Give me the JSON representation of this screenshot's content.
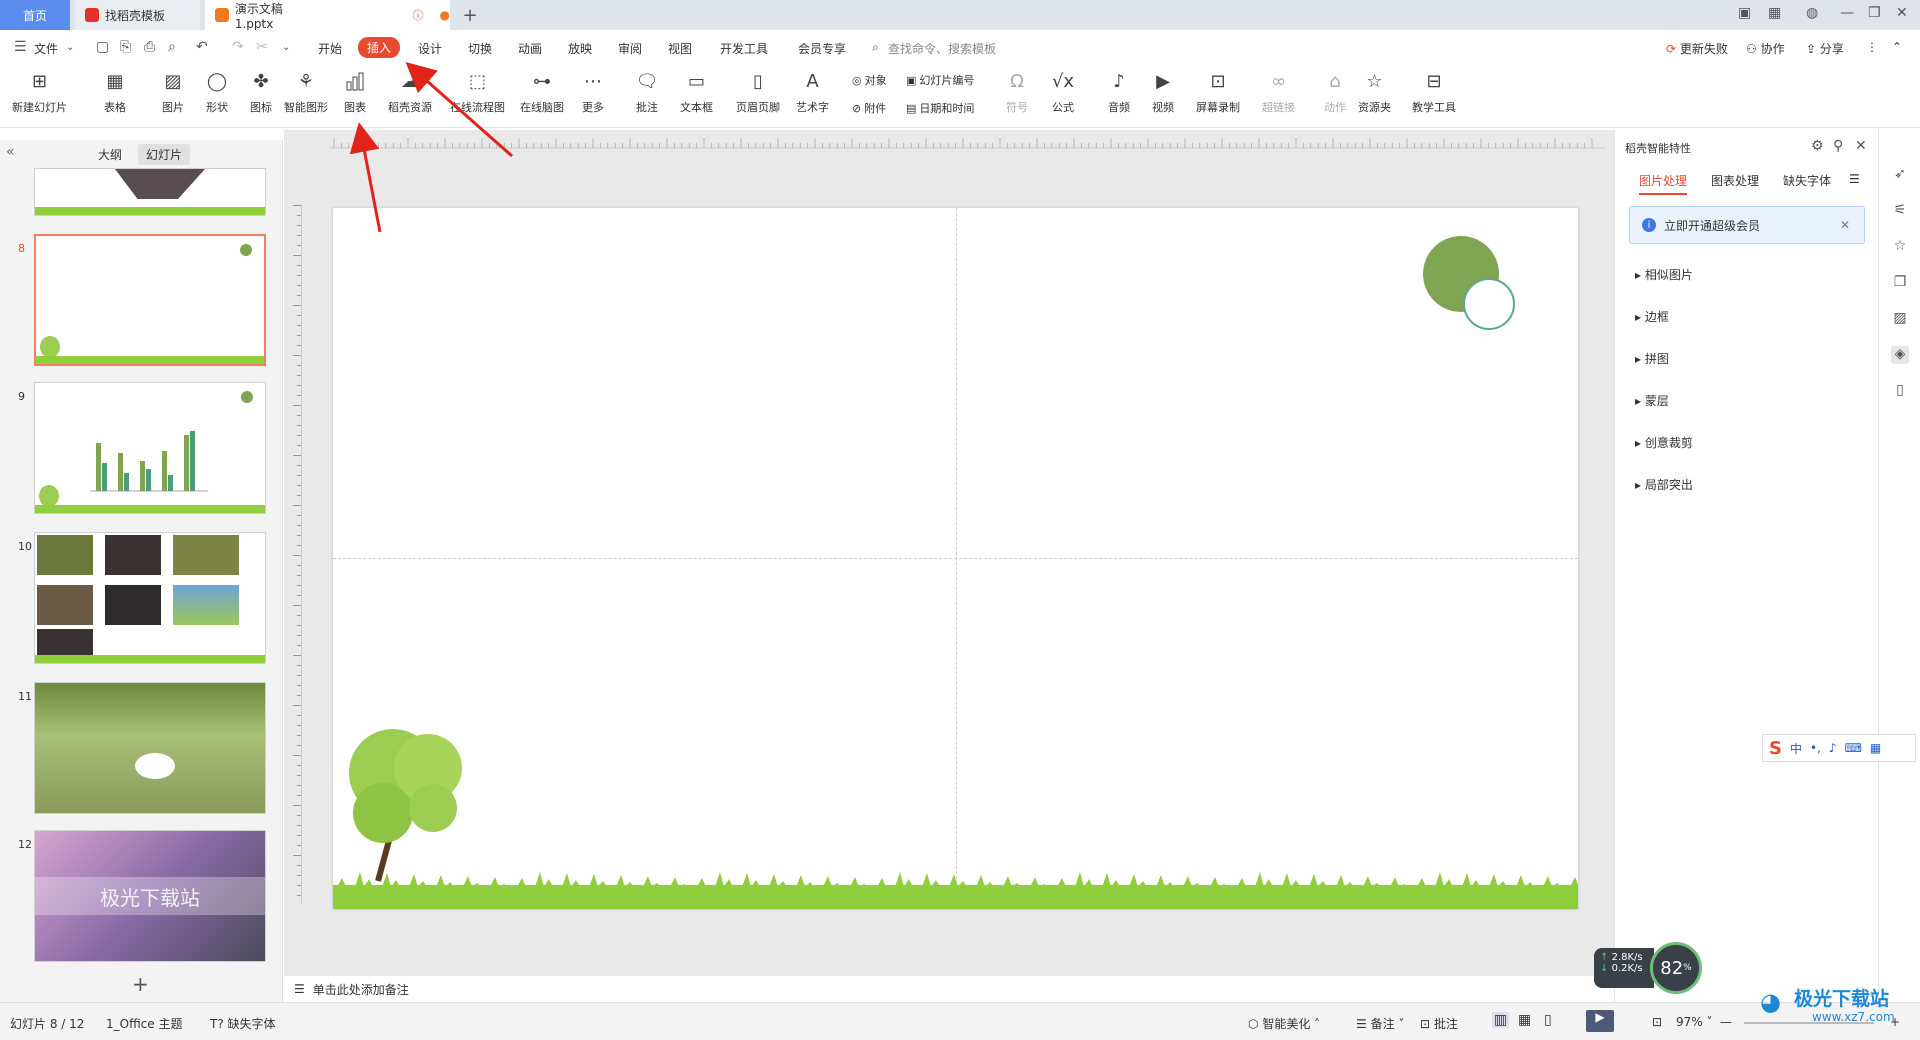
{
  "tabs": {
    "home": "首页",
    "template": "找稻壳模板",
    "document": "演示文稿1.pptx",
    "add": "+"
  },
  "menu": {
    "file": "文件",
    "items": [
      "开始",
      "插入",
      "设计",
      "切换",
      "动画",
      "放映",
      "审阅",
      "视图",
      "开发工具",
      "会员专享"
    ],
    "active": "插入",
    "search_placeholder": "查找命令、搜索模板",
    "update_failed": "更新失败",
    "collaborate": "协作",
    "share": "分享"
  },
  "ribbon": {
    "buttons": [
      {
        "label": "新建幻灯片",
        "icon": "new-slide-icon"
      },
      {
        "label": "表格",
        "icon": "table-icon"
      },
      {
        "label": "图片",
        "icon": "picture-icon"
      },
      {
        "label": "形状",
        "icon": "shape-icon"
      },
      {
        "label": "图标",
        "icon": "icons-icon"
      },
      {
        "label": "智能图形",
        "icon": "smartart-icon"
      },
      {
        "label": "图表",
        "icon": "chart-icon"
      },
      {
        "label": "稻壳资源",
        "icon": "docer-resource-icon"
      },
      {
        "label": "在线流程图",
        "icon": "flowchart-icon"
      },
      {
        "label": "在线脑图",
        "icon": "mindmap-icon"
      },
      {
        "label": "更多",
        "icon": "more-icon"
      },
      {
        "label": "批注",
        "icon": "comment-icon"
      },
      {
        "label": "文本框",
        "icon": "textbox-icon"
      },
      {
        "label": "页眉页脚",
        "icon": "header-footer-icon"
      },
      {
        "label": "艺术字",
        "icon": "wordart-icon"
      },
      {
        "label": "符号",
        "icon": "symbol-icon"
      },
      {
        "label": "公式",
        "icon": "formula-icon"
      },
      {
        "label": "音频",
        "icon": "audio-icon"
      },
      {
        "label": "视频",
        "icon": "video-icon"
      },
      {
        "label": "屏幕录制",
        "icon": "screen-record-icon"
      },
      {
        "label": "超链接",
        "icon": "hyperlink-icon"
      },
      {
        "label": "动作",
        "icon": "action-icon"
      },
      {
        "label": "资源夹",
        "icon": "resource-folder-icon"
      },
      {
        "label": "教学工具",
        "icon": "teaching-tools-icon"
      }
    ],
    "small": {
      "object": "对象",
      "attachment": "附件",
      "slide_number": "幻灯片编号",
      "date_time": "日期和时间"
    }
  },
  "left_panel": {
    "outline_tab": "大纲",
    "slides_tab": "幻灯片",
    "slide_numbers": [
      "8",
      "9",
      "10",
      "11",
      "12"
    ],
    "slide12_text": "极光下载站",
    "add_slide": "+"
  },
  "notes": {
    "placeholder": "单击此处添加备注"
  },
  "right_panel": {
    "title": "稻壳智能特性",
    "tabs": [
      "图片处理",
      "图表处理",
      "缺失字体"
    ],
    "banner": "立即开通超级会员",
    "items": [
      "相似图片",
      "边框",
      "拼图",
      "蒙层",
      "创意裁剪",
      "局部突出"
    ]
  },
  "status": {
    "slide_info": "幻灯片 8 / 12",
    "theme": "1_Office 主题",
    "missing_font": "缺失字体",
    "smart_beautify": "智能美化",
    "notes": "备注",
    "comments": "批注",
    "zoom": "97%",
    "net_up": "2.8K/s",
    "net_down": "0.2K/s",
    "cpu": "82",
    "watermark": "极光下载站",
    "watermark_url": "www.xz7.com"
  },
  "colors": {
    "accent": "#e8492f",
    "green_circle": "#7fa552",
    "grass": "#8fce3c",
    "arrow": "#e0241a"
  }
}
